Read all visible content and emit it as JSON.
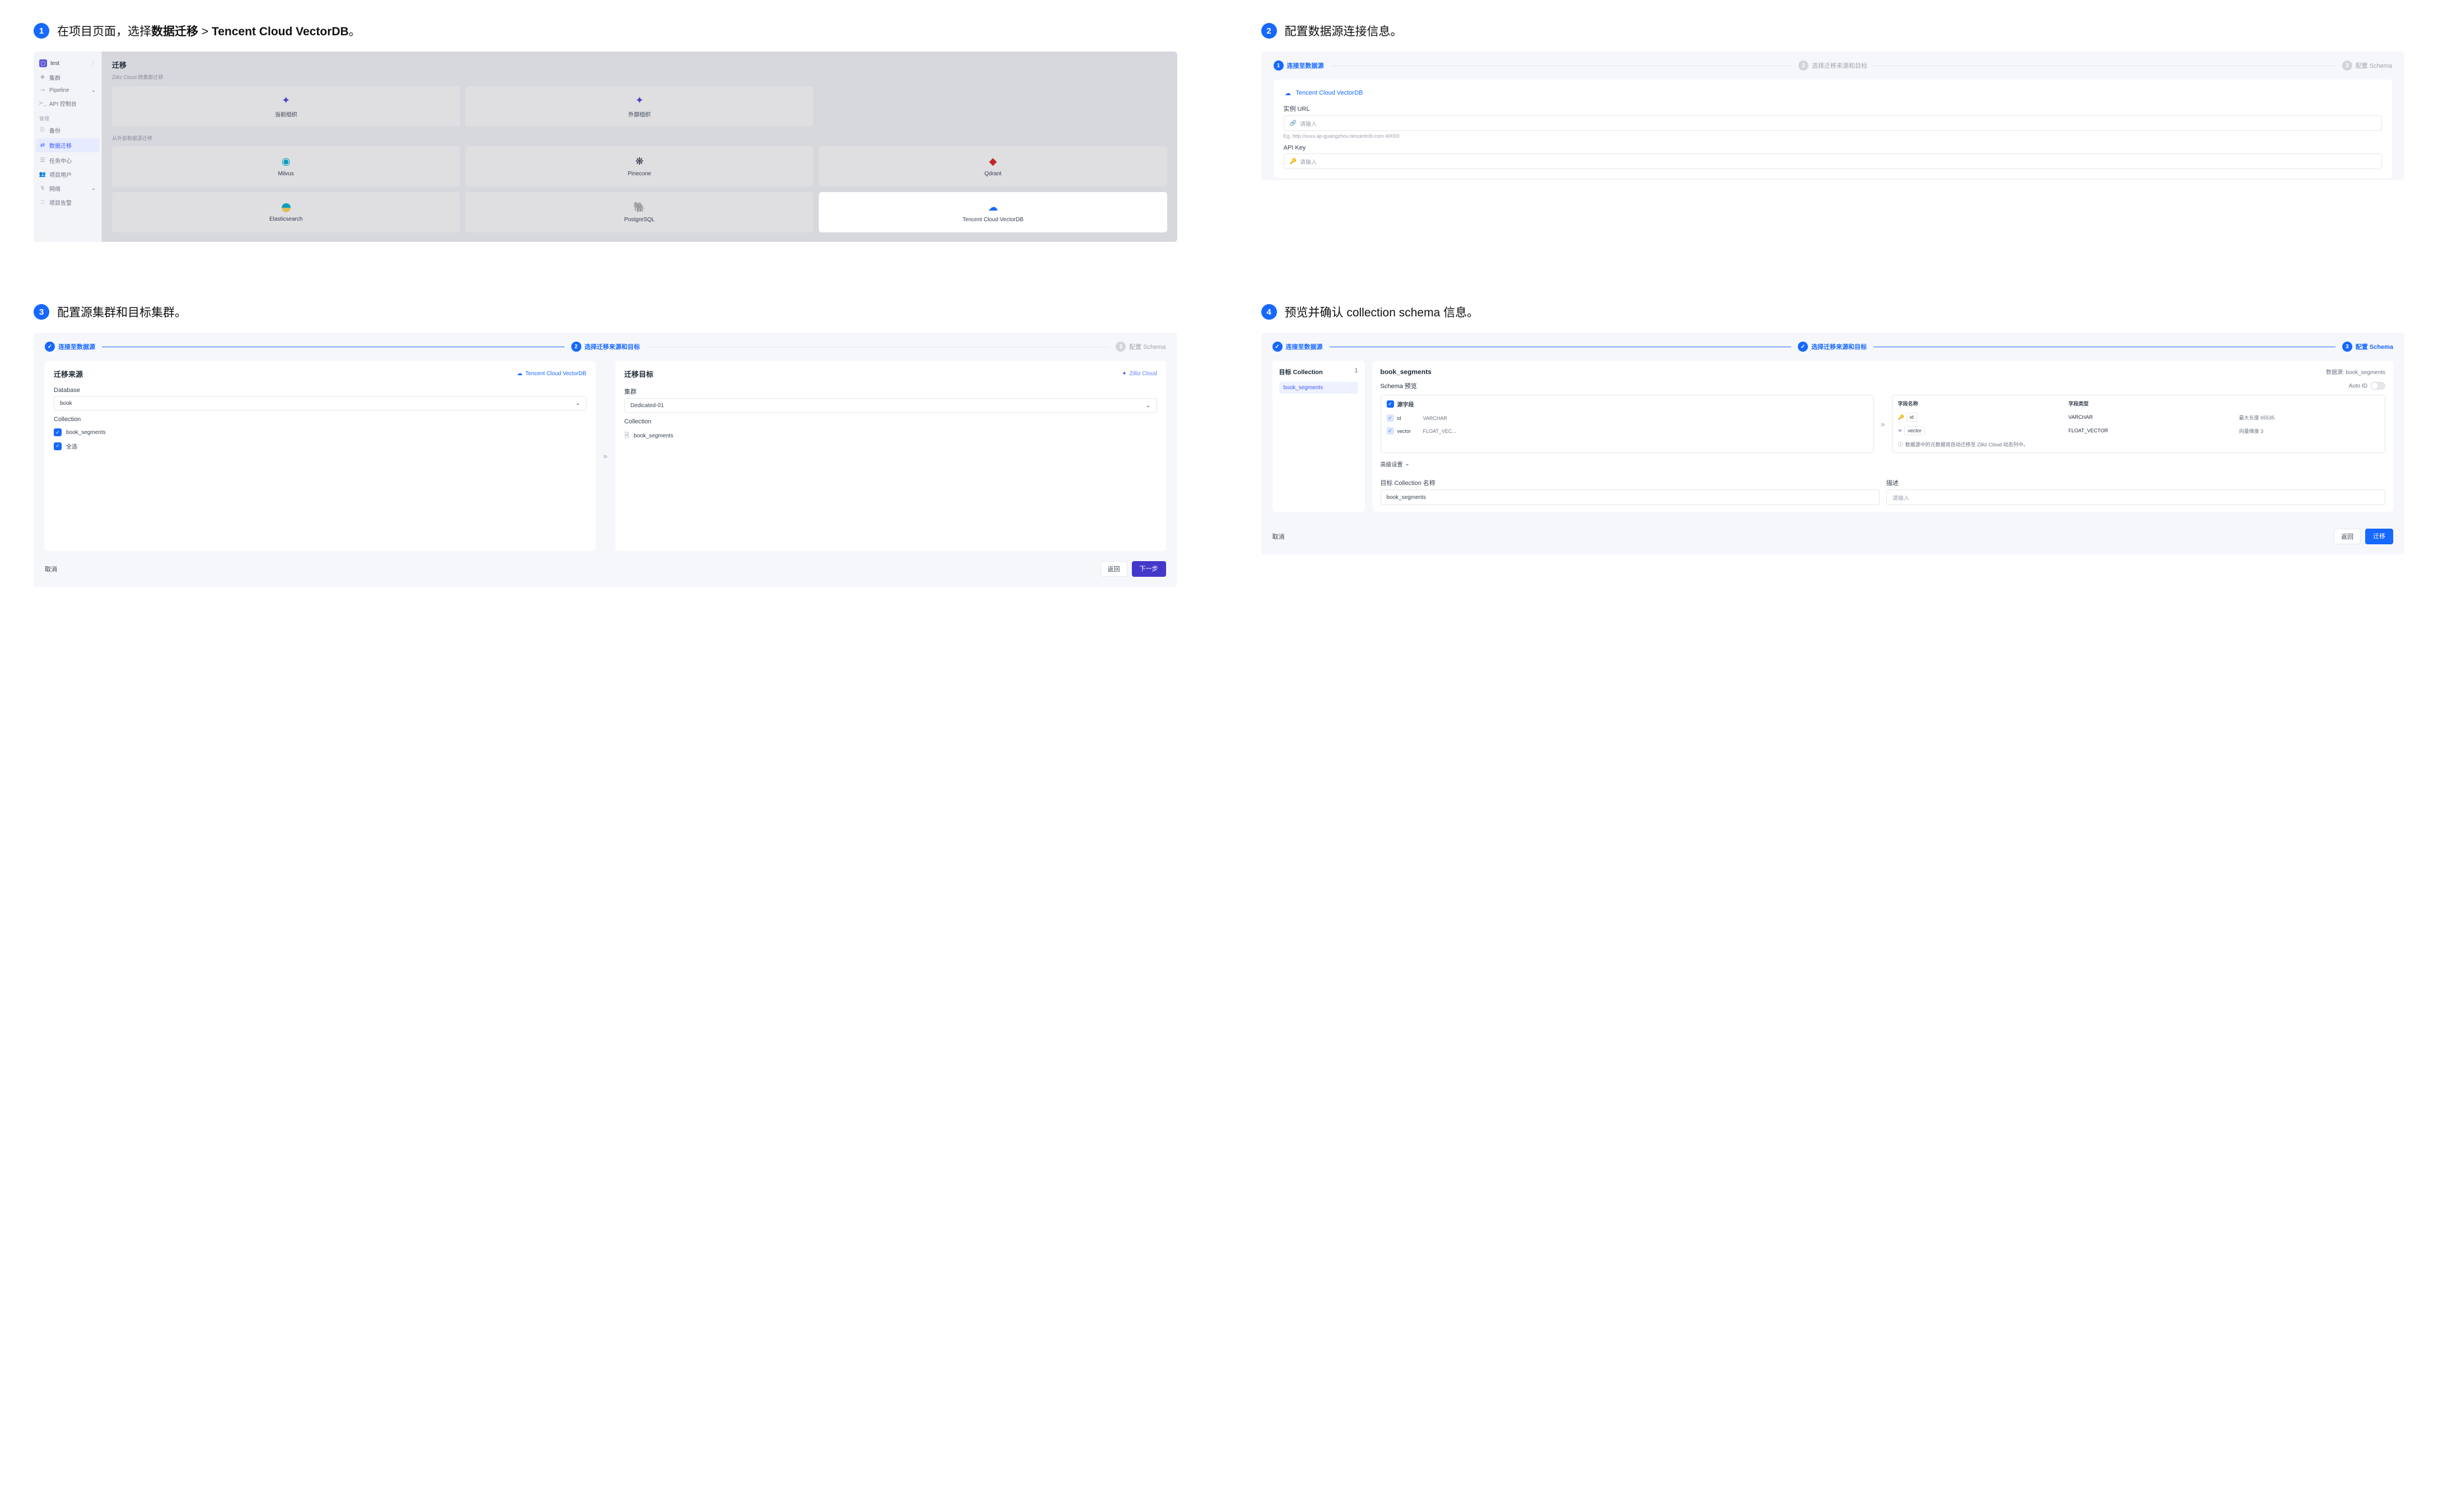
{
  "steps": {
    "s1": {
      "title_pre": "在项目页面，选择",
      "title_bold": "数据迁移",
      "title_mid": " > ",
      "title_bold2": "Tencent Cloud VectorDB",
      "title_post": "。",
      "sidebar": {
        "project": "test",
        "items_main": [
          "集群",
          "Pipeline",
          "API 控制台"
        ],
        "section_label": "管理",
        "items_manage": [
          "备份",
          "数据迁移",
          "任务中心",
          "项目用户",
          "网络",
          "项目告警"
        ],
        "active_index": 1
      },
      "main": {
        "heading": "迁移",
        "sub1": "Zilliz Cloud 跨集群迁移",
        "tiles_row1": [
          "当前组织",
          "外部组织"
        ],
        "sub2": "从外部数据源迁移",
        "tiles_row2": [
          "Milvus",
          "Pinecone",
          "Qdrant"
        ],
        "tiles_row3": [
          "Elasticsearch",
          "PostgreSQL",
          "Tencent Cloud VectorDB"
        ]
      }
    },
    "s2": {
      "title": "配置数据源连接信息。",
      "stepper": [
        "连接至数据源",
        "选择迁移来源和目标",
        "配置 Schema"
      ],
      "source_name": "Tencent Cloud VectorDB",
      "f1_label": "实例 URL",
      "f1_placeholder": "请输入",
      "f1_hint": "Eg. http://xxxx.ap-guangzhou.tencentclb.com:40000",
      "f2_label": "API Key",
      "f2_placeholder": "请输入"
    },
    "s3": {
      "title": "配置源集群和目标集群。",
      "stepper": [
        "连接至数据源",
        "选择迁移来源和目标",
        "配置 Schema"
      ],
      "left": {
        "heading": "迁移来源",
        "badge": "Tencent Cloud VectorDB",
        "db_label": "Database",
        "db_value": "book",
        "coll_label": "Collection",
        "coll_item": "book_segments",
        "select_all": "全选"
      },
      "right": {
        "heading": "迁移目标",
        "badge": "Zilliz Cloud",
        "cluster_label": "集群",
        "cluster_value": "Dedicated-01",
        "coll_label": "Collection",
        "coll_item": "book_segments"
      },
      "footer": {
        "cancel": "取消",
        "back": "返回",
        "next": "下一步"
      }
    },
    "s4": {
      "title": "预览并确认 collection schema 信息。",
      "stepper": [
        "连接至数据源",
        "选择迁移来源和目标",
        "配置 Schema"
      ],
      "left": {
        "heading": "目标 Collection",
        "count": "1",
        "item": "book_segments"
      },
      "right": {
        "name": "book_segments",
        "datasource_prefix": "数据源: ",
        "datasource": "book_segments",
        "schema_preview": "Schema 预览",
        "auto_id": "Auto ID",
        "src_heading": "源字段",
        "src_fields": [
          {
            "name": "id",
            "type": "VARCHAR"
          },
          {
            "name": "vector",
            "type": "FLOAT_VEC..."
          }
        ],
        "tgt_headers": [
          "字段名称",
          "字段类型",
          ""
        ],
        "tgt_fields": [
          {
            "name": "id",
            "type": "VARCHAR",
            "meta_label": "最大长度",
            "meta_val": "65535"
          },
          {
            "name": "vector",
            "type": "FLOAT_VECTOR",
            "meta_label": "向量维度",
            "meta_val": "3"
          }
        ],
        "info": "数据源中的元数据将自动迁移至 Zilliz Cloud 动态列中。",
        "adv": "高级设置",
        "target_name_label": "目标 Collection 名称",
        "target_name_value": "book_segments",
        "desc_label": "描述",
        "desc_placeholder": "请输入"
      },
      "footer": {
        "cancel": "取消",
        "back": "返回",
        "migrate": "迁移"
      }
    }
  }
}
